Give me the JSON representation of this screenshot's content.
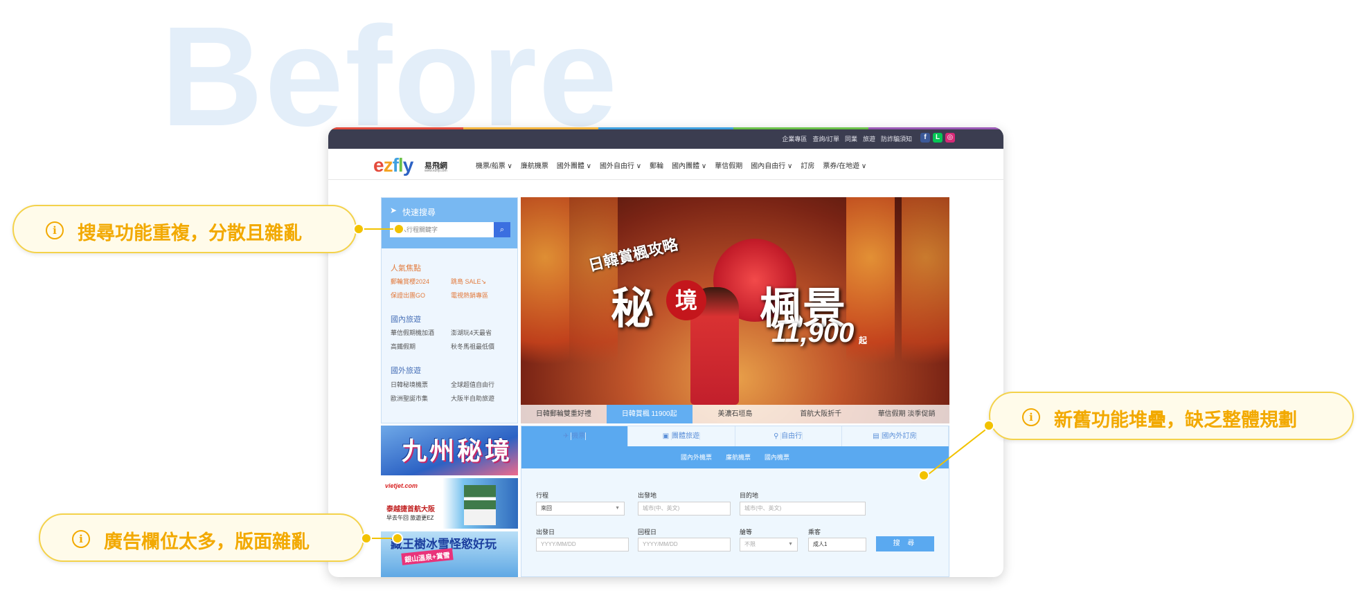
{
  "heading": "Before",
  "colors": {
    "accent_yellow": "#f2a900",
    "nav_dark": "#3b3d50",
    "brand_blue": "#5aa9f0"
  },
  "topbar": {
    "links": [
      "企業專區",
      "查詢/訂單",
      "同業",
      "旅遊",
      "防詐騙須知"
    ],
    "social_icons": [
      "facebook-icon",
      "line-icon",
      "instagram-icon"
    ]
  },
  "logo": {
    "brand": "ezfly",
    "chinese": "易飛網",
    "url": "www.ezfly.com"
  },
  "menu": [
    "機票/船票 ∨",
    "廉航機票",
    "國外團體 ∨",
    "國外自由行 ∨",
    "郵輪",
    "國內團體 ∨",
    "華信假期",
    "國內自由行 ∨",
    "訂房",
    "票券/在地遊 ∨"
  ],
  "sidebar": {
    "title": "快速搜尋",
    "search_placeholder": "輸入行程關鍵字",
    "sections": [
      {
        "title": "人氣焦點",
        "items": [
          "郵輪賞櫻2024",
          "跳島 SALE↘",
          "保證出團GO",
          "電視熱銷專區"
        ]
      },
      {
        "title": "國內旅遊",
        "items": [
          "華信假期機加酒",
          "澎湖玩4天最省",
          "高鐵假期",
          "秋冬馬祖最低價"
        ]
      },
      {
        "title": "國外旅遊",
        "items": [
          "日韓秘境機票",
          "全球超值自由行",
          "歐洲聖誕市集",
          "大阪半自助旅遊"
        ]
      }
    ]
  },
  "hero": {
    "subtitle": "日韓賞楓攻略",
    "title_left": "秘",
    "title_seal": "境",
    "title_right": "楓景",
    "price": "11,900",
    "price_unit": "起",
    "tabs": [
      "日韓郵輪雙重好禮",
      "日韓賞楓 11900起",
      "美濃石垣島",
      "首航大阪折千",
      "華信假期 淡季促銷"
    ],
    "active_tab": 1
  },
  "ads": {
    "ad1_title": "九州秘境",
    "ad2_brand": "vietjet.com",
    "ad2_line1": "泰越捷首航大阪",
    "ad2_line2": "早去午回 旅遊更EZ",
    "ad3_title": "藏王樹冰雪怪慾好玩",
    "ad3_sub": "銀山溫泉+賞雪"
  },
  "booking": {
    "tabs": [
      "機票",
      "團體旅遊",
      "自由行",
      "國內外訂房"
    ],
    "subtabs": [
      "國內外機票",
      "廉航機票",
      "國內機票"
    ],
    "trip_label": "行程",
    "trip_value": "來回",
    "from_label": "出發地",
    "from_placeholder": "城市(中、英文)",
    "to_label": "目的地",
    "to_placeholder": "城市(中、英文)",
    "depart_label": "出發日",
    "depart_placeholder": "YYYY/MM/DD",
    "return_label": "回程日",
    "return_placeholder": "YYYY/MM/DD",
    "class_label": "艙等",
    "class_value": "不限",
    "pax_label": "乘客",
    "pax_value": "成人1",
    "search_button": "搜 尋"
  },
  "callouts": [
    {
      "text": "搜尋功能重複，分散且雜亂"
    },
    {
      "text": "新舊功能堆疊，缺乏整體規劃"
    },
    {
      "text": "廣告欄位太多，版面雜亂"
    }
  ]
}
